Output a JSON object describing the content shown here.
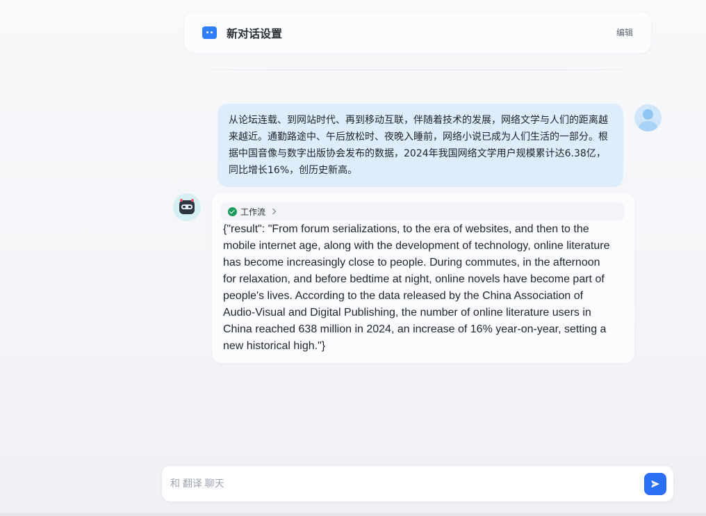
{
  "header": {
    "title": "新对话设置",
    "edit_label": "编辑"
  },
  "messages": {
    "user": {
      "text": "从论坛连载、到网站时代、再到移动互联，伴随着技术的发展，网络文学与人们的距离越来越近。通勤路途中、午后放松时、夜晚入睡前，网络小说已成为人们生活的一部分。根据中国音像与数字出版协会发布的数据，2024年我国网络文学用户规模累计达6.38亿，同比增长16%，创历史新高。"
    },
    "bot": {
      "workflow_label": "工作流",
      "text": "{\"result\": \"From forum serializations, to the era of websites, and then to the mobile internet age, along with the development of technology, online literature has become increasingly close to people. During commutes, in the afternoon for relaxation, and before bedtime at night, online novels have become part of people's lives. According to the data released by the China Association of Audio-Visual and Digital Publishing, the number of online literature users in China reached 638 million in 2024, an increase of 16% year-on-year, setting a new historical high.\"}"
    }
  },
  "composer": {
    "placeholder": "和 翻译 聊天",
    "value": ""
  },
  "icons": {
    "header": "chat-bot-icon",
    "workflow_status": "check-circle-icon",
    "workflow_expand": "chevron-right-icon",
    "send": "send-icon"
  },
  "colors": {
    "accent": "#2a6ff5",
    "user_bubble": "#deedfc",
    "success": "#1a9a5a"
  }
}
